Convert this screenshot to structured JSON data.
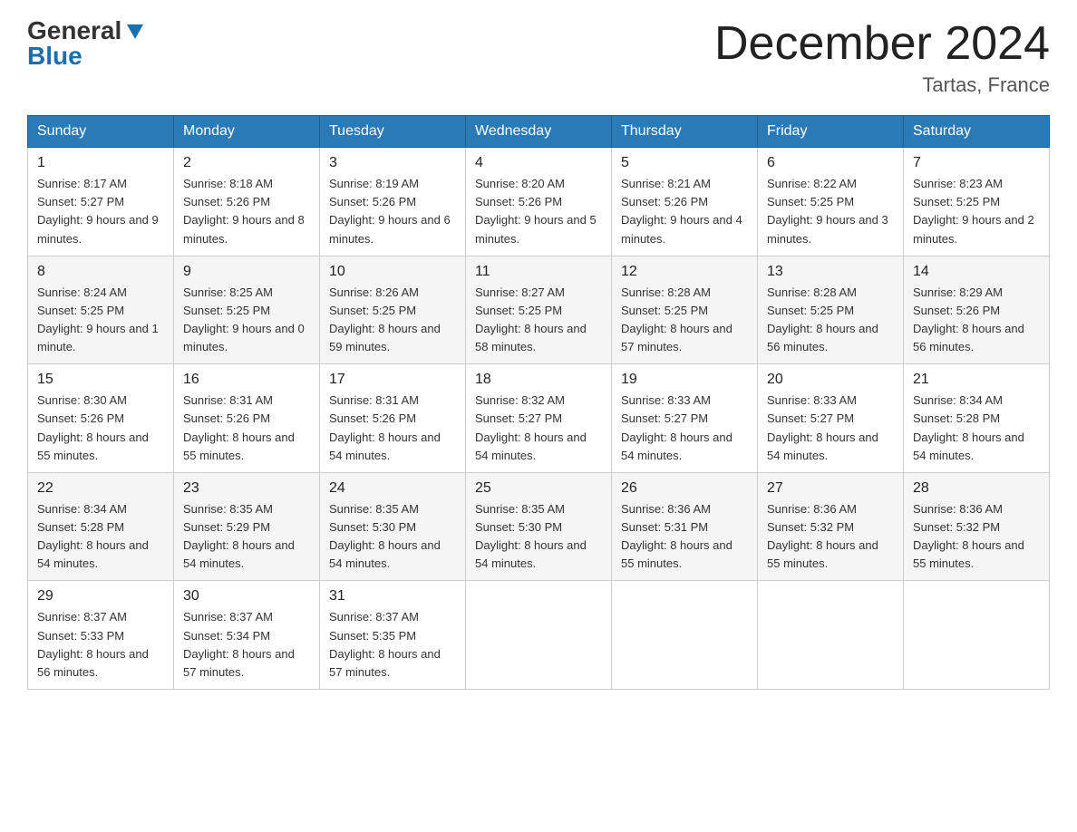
{
  "header": {
    "logo_general": "General",
    "logo_blue": "Blue",
    "month_title": "December 2024",
    "location": "Tartas, France"
  },
  "days_of_week": [
    "Sunday",
    "Monday",
    "Tuesday",
    "Wednesday",
    "Thursday",
    "Friday",
    "Saturday"
  ],
  "weeks": [
    [
      {
        "day": "1",
        "sunrise": "Sunrise: 8:17 AM",
        "sunset": "Sunset: 5:27 PM",
        "daylight": "Daylight: 9 hours and 9 minutes."
      },
      {
        "day": "2",
        "sunrise": "Sunrise: 8:18 AM",
        "sunset": "Sunset: 5:26 PM",
        "daylight": "Daylight: 9 hours and 8 minutes."
      },
      {
        "day": "3",
        "sunrise": "Sunrise: 8:19 AM",
        "sunset": "Sunset: 5:26 PM",
        "daylight": "Daylight: 9 hours and 6 minutes."
      },
      {
        "day": "4",
        "sunrise": "Sunrise: 8:20 AM",
        "sunset": "Sunset: 5:26 PM",
        "daylight": "Daylight: 9 hours and 5 minutes."
      },
      {
        "day": "5",
        "sunrise": "Sunrise: 8:21 AM",
        "sunset": "Sunset: 5:26 PM",
        "daylight": "Daylight: 9 hours and 4 minutes."
      },
      {
        "day": "6",
        "sunrise": "Sunrise: 8:22 AM",
        "sunset": "Sunset: 5:25 PM",
        "daylight": "Daylight: 9 hours and 3 minutes."
      },
      {
        "day": "7",
        "sunrise": "Sunrise: 8:23 AM",
        "sunset": "Sunset: 5:25 PM",
        "daylight": "Daylight: 9 hours and 2 minutes."
      }
    ],
    [
      {
        "day": "8",
        "sunrise": "Sunrise: 8:24 AM",
        "sunset": "Sunset: 5:25 PM",
        "daylight": "Daylight: 9 hours and 1 minute."
      },
      {
        "day": "9",
        "sunrise": "Sunrise: 8:25 AM",
        "sunset": "Sunset: 5:25 PM",
        "daylight": "Daylight: 9 hours and 0 minutes."
      },
      {
        "day": "10",
        "sunrise": "Sunrise: 8:26 AM",
        "sunset": "Sunset: 5:25 PM",
        "daylight": "Daylight: 8 hours and 59 minutes."
      },
      {
        "day": "11",
        "sunrise": "Sunrise: 8:27 AM",
        "sunset": "Sunset: 5:25 PM",
        "daylight": "Daylight: 8 hours and 58 minutes."
      },
      {
        "day": "12",
        "sunrise": "Sunrise: 8:28 AM",
        "sunset": "Sunset: 5:25 PM",
        "daylight": "Daylight: 8 hours and 57 minutes."
      },
      {
        "day": "13",
        "sunrise": "Sunrise: 8:28 AM",
        "sunset": "Sunset: 5:25 PM",
        "daylight": "Daylight: 8 hours and 56 minutes."
      },
      {
        "day": "14",
        "sunrise": "Sunrise: 8:29 AM",
        "sunset": "Sunset: 5:26 PM",
        "daylight": "Daylight: 8 hours and 56 minutes."
      }
    ],
    [
      {
        "day": "15",
        "sunrise": "Sunrise: 8:30 AM",
        "sunset": "Sunset: 5:26 PM",
        "daylight": "Daylight: 8 hours and 55 minutes."
      },
      {
        "day": "16",
        "sunrise": "Sunrise: 8:31 AM",
        "sunset": "Sunset: 5:26 PM",
        "daylight": "Daylight: 8 hours and 55 minutes."
      },
      {
        "day": "17",
        "sunrise": "Sunrise: 8:31 AM",
        "sunset": "Sunset: 5:26 PM",
        "daylight": "Daylight: 8 hours and 54 minutes."
      },
      {
        "day": "18",
        "sunrise": "Sunrise: 8:32 AM",
        "sunset": "Sunset: 5:27 PM",
        "daylight": "Daylight: 8 hours and 54 minutes."
      },
      {
        "day": "19",
        "sunrise": "Sunrise: 8:33 AM",
        "sunset": "Sunset: 5:27 PM",
        "daylight": "Daylight: 8 hours and 54 minutes."
      },
      {
        "day": "20",
        "sunrise": "Sunrise: 8:33 AM",
        "sunset": "Sunset: 5:27 PM",
        "daylight": "Daylight: 8 hours and 54 minutes."
      },
      {
        "day": "21",
        "sunrise": "Sunrise: 8:34 AM",
        "sunset": "Sunset: 5:28 PM",
        "daylight": "Daylight: 8 hours and 54 minutes."
      }
    ],
    [
      {
        "day": "22",
        "sunrise": "Sunrise: 8:34 AM",
        "sunset": "Sunset: 5:28 PM",
        "daylight": "Daylight: 8 hours and 54 minutes."
      },
      {
        "day": "23",
        "sunrise": "Sunrise: 8:35 AM",
        "sunset": "Sunset: 5:29 PM",
        "daylight": "Daylight: 8 hours and 54 minutes."
      },
      {
        "day": "24",
        "sunrise": "Sunrise: 8:35 AM",
        "sunset": "Sunset: 5:30 PM",
        "daylight": "Daylight: 8 hours and 54 minutes."
      },
      {
        "day": "25",
        "sunrise": "Sunrise: 8:35 AM",
        "sunset": "Sunset: 5:30 PM",
        "daylight": "Daylight: 8 hours and 54 minutes."
      },
      {
        "day": "26",
        "sunrise": "Sunrise: 8:36 AM",
        "sunset": "Sunset: 5:31 PM",
        "daylight": "Daylight: 8 hours and 55 minutes."
      },
      {
        "day": "27",
        "sunrise": "Sunrise: 8:36 AM",
        "sunset": "Sunset: 5:32 PM",
        "daylight": "Daylight: 8 hours and 55 minutes."
      },
      {
        "day": "28",
        "sunrise": "Sunrise: 8:36 AM",
        "sunset": "Sunset: 5:32 PM",
        "daylight": "Daylight: 8 hours and 55 minutes."
      }
    ],
    [
      {
        "day": "29",
        "sunrise": "Sunrise: 8:37 AM",
        "sunset": "Sunset: 5:33 PM",
        "daylight": "Daylight: 8 hours and 56 minutes."
      },
      {
        "day": "30",
        "sunrise": "Sunrise: 8:37 AM",
        "sunset": "Sunset: 5:34 PM",
        "daylight": "Daylight: 8 hours and 57 minutes."
      },
      {
        "day": "31",
        "sunrise": "Sunrise: 8:37 AM",
        "sunset": "Sunset: 5:35 PM",
        "daylight": "Daylight: 8 hours and 57 minutes."
      },
      null,
      null,
      null,
      null
    ]
  ]
}
